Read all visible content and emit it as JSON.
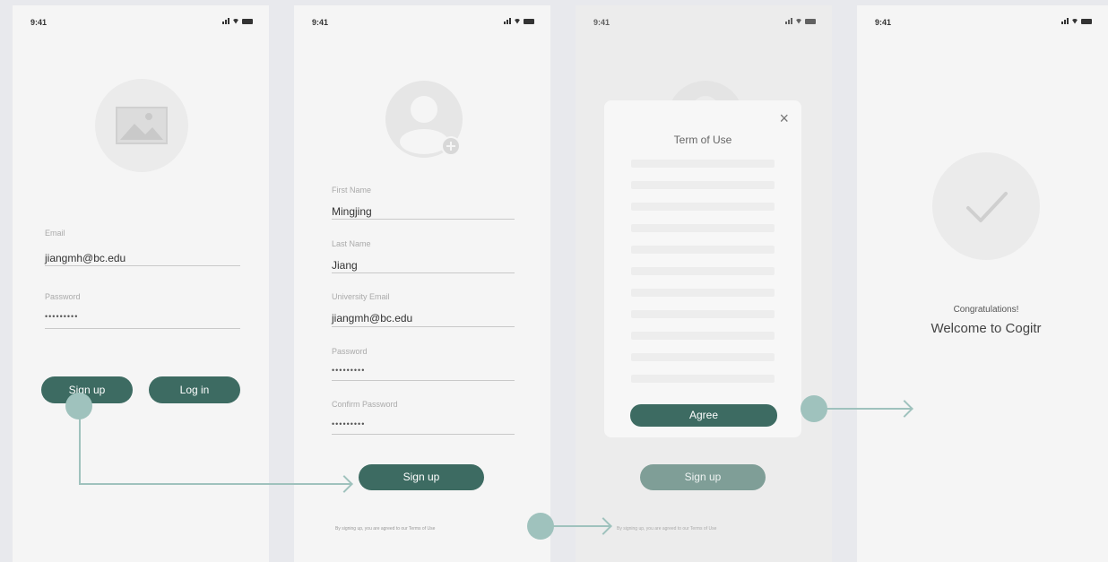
{
  "status": {
    "time": "9:41"
  },
  "screen1": {
    "email_label": "Email",
    "email_value": "jiangmh@bc.edu",
    "password_label": "Password",
    "password_value": "•••••••••",
    "signup_label": "Sign up",
    "login_label": "Log in"
  },
  "screen2": {
    "first_name_label": "First Name",
    "first_name_value": "Mingjing",
    "last_name_label": "Last Name",
    "last_name_value": "Jiang",
    "email_label": "University Email",
    "email_value": "jiangmh@bc.edu",
    "password_label": "Password",
    "password_value": "•••••••••",
    "confirm_label": "Confirm Password",
    "confirm_value": "•••••••••",
    "signup_label": "Sign up",
    "terms_text": "By signing up, you are agreed to our Terms of Use"
  },
  "screen3": {
    "modal_title": "Term of Use",
    "close_label": "×",
    "agree_label": "Agree",
    "signup_label": "Sign up",
    "terms_text": "By signing up, you are agreed to our Terms of Use"
  },
  "screen4": {
    "congrats_text": "Congratulations!",
    "welcome_text": "Welcome to Cogitr"
  },
  "colors": {
    "primary": "#3d6b62",
    "connector": "#9fc2bd",
    "background": "#e8e9ed",
    "screen": "#f5f5f5"
  }
}
